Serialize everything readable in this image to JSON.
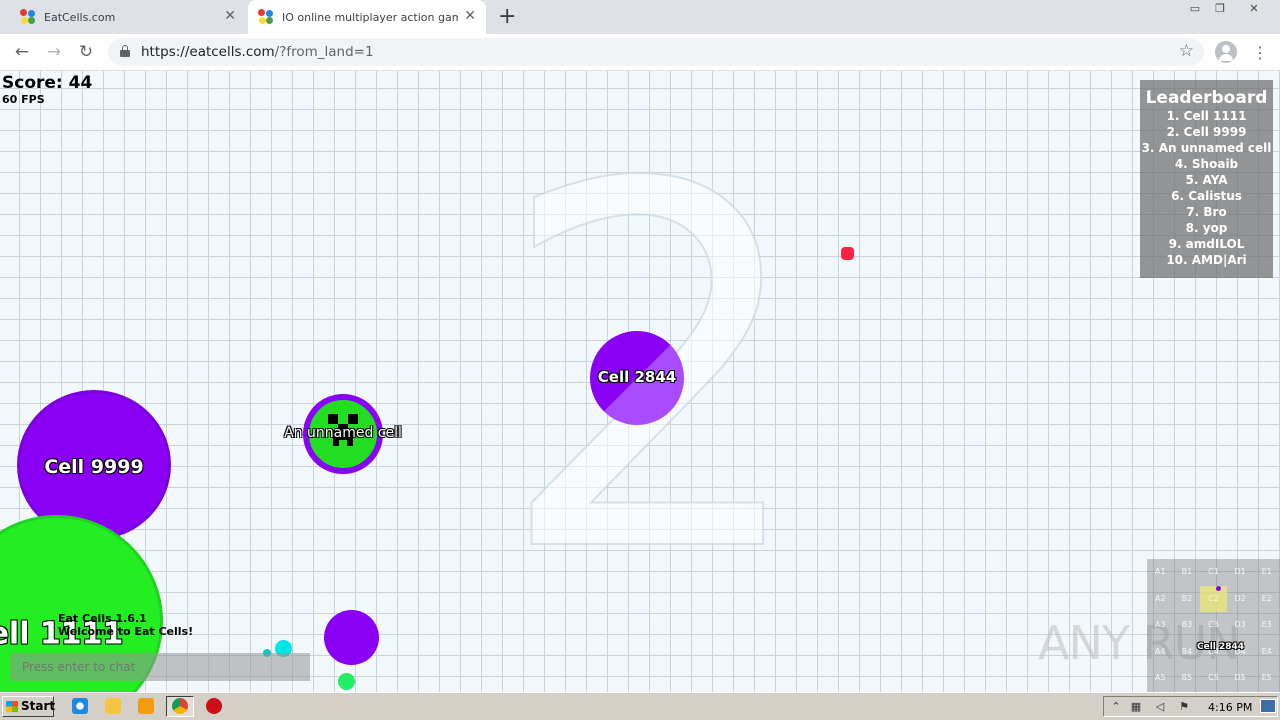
{
  "browser": {
    "tabs": [
      {
        "title": "EatCells.com",
        "active": false
      },
      {
        "title": "IO online multiplayer action game. S",
        "active": true
      }
    ],
    "close_glyph": "✕",
    "new_tab_glyph": "+",
    "url_host": "https://eatcells.com",
    "url_path": "/?from_land=1",
    "window_controls": {
      "minimize": "▭",
      "restore": "❐",
      "close": "✕"
    }
  },
  "game": {
    "score_label": "Score: 44",
    "fps_label": "60 FPS",
    "background_number": "2",
    "leaderboard": {
      "title": "Leaderboard",
      "entries": [
        "1. Cell 1111",
        "2. Cell 9999",
        "3. An unnamed cell",
        "4. Shoaib",
        "5. AYA",
        "6. Calistus",
        "7. Bro",
        "8. yop",
        "9. amdILOL",
        "10. AMD|Ari"
      ]
    },
    "cells": {
      "cell_2844": "Cell 2844",
      "cell_9999": "Cell 9999",
      "unnamed": "An unnamed cell",
      "cell_1111": "ell 1111"
    },
    "chat": {
      "version": "Eat Cells 1.6.1",
      "welcome": "Welcome to Eat Cells!",
      "placeholder": "Press enter to chat"
    },
    "minimap": {
      "rows": [
        [
          "A1",
          "B1",
          "C1",
          "D1",
          "E1"
        ],
        [
          "A2",
          "B2",
          "C2",
          "D2",
          "E2"
        ],
        [
          "A3",
          "B3",
          "C3",
          "D3",
          "E3"
        ],
        [
          "A4",
          "B4",
          "C4",
          "D4",
          "E4"
        ],
        [
          "A5",
          "B5",
          "C5",
          "D5",
          "E5"
        ]
      ],
      "active_cell": "C2",
      "player_label": "Cell 2844"
    },
    "colors": {
      "purple": "#8a00f5",
      "green_player": "#22dd22",
      "cyan": "#00e5e5",
      "red_food": "#ff2244"
    }
  },
  "watermark": "ANY RUN",
  "taskbar": {
    "start_label": "Start",
    "clock": "4:16 PM",
    "icons": [
      "ie-icon",
      "explorer-icon",
      "media-player-icon",
      "chrome-icon",
      "opera-icon"
    ]
  }
}
